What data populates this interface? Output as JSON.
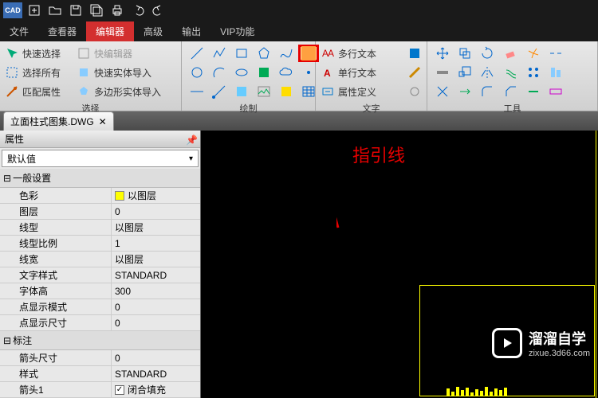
{
  "app": {
    "logo": "CAD"
  },
  "menu": {
    "items": [
      "文件",
      "查看器",
      "编辑器",
      "高级",
      "输出",
      "VIP功能"
    ],
    "active": 2
  },
  "ribbon": {
    "select": {
      "label": "选择",
      "quick": "快速选择",
      "quick_edit": "快编辑器",
      "all": "选择所有",
      "solid_import": "快速实体导入",
      "match": "匹配属性",
      "poly_import": "多边形实体导入"
    },
    "draw": {
      "label": "绘制"
    },
    "text": {
      "label": "文字",
      "multi": "多行文本",
      "single": "单行文本",
      "attr": "属性定义"
    },
    "tools": {
      "label": "工具"
    }
  },
  "doc": {
    "tab": "立面柱式图集.DWG"
  },
  "panel": {
    "title": "属性",
    "combo": "默认值"
  },
  "props": {
    "sec1": "一般设置",
    "sec2": "标注",
    "rows": [
      {
        "k": "色彩",
        "v": "以图层",
        "sw": true
      },
      {
        "k": "图层",
        "v": "0"
      },
      {
        "k": "线型",
        "v": "以图层"
      },
      {
        "k": "线型比例",
        "v": "1"
      },
      {
        "k": "线宽",
        "v": "以图层"
      },
      {
        "k": "文字样式",
        "v": "STANDARD"
      },
      {
        "k": "字体高",
        "v": "300"
      },
      {
        "k": "点显示模式",
        "v": "0"
      },
      {
        "k": "点显示尺寸",
        "v": "0"
      }
    ],
    "rows2": [
      {
        "k": "箭头尺寸",
        "v": "0"
      },
      {
        "k": "样式",
        "v": "STANDARD"
      },
      {
        "k": "箭头1",
        "v": "闭合填充",
        "chk": true
      }
    ]
  },
  "annotation": {
    "text": "指引线"
  },
  "watermark": {
    "brand": "溜溜自学",
    "url": "zixue.3d66.com"
  }
}
